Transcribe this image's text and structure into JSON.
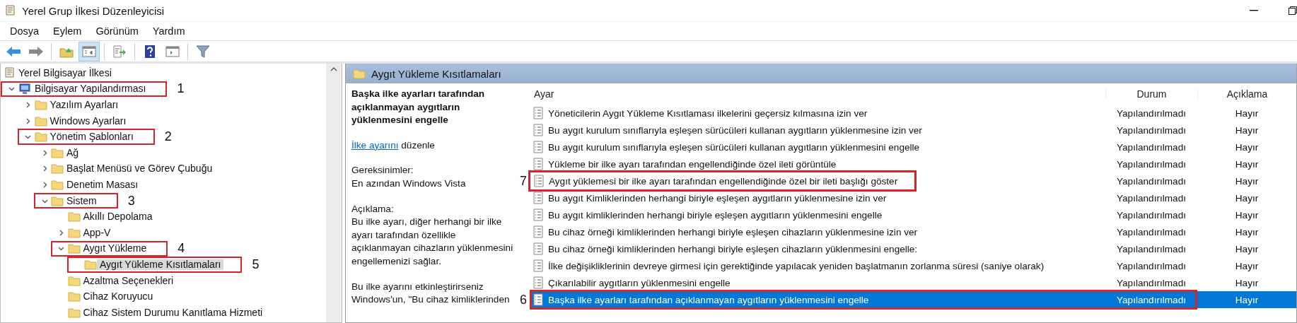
{
  "window": {
    "title": "Yerel Grup İlkesi Düzenleyicisi"
  },
  "menu": [
    "Dosya",
    "Eylem",
    "Görünüm",
    "Yardım"
  ],
  "toolbar": [
    {
      "kind": "back",
      "pressed": false
    },
    {
      "kind": "forward",
      "pressed": false
    },
    {
      "kind": "sep"
    },
    {
      "kind": "up",
      "pressed": false
    },
    {
      "kind": "tree",
      "pressed": true
    },
    {
      "kind": "sep"
    },
    {
      "kind": "export",
      "pressed": false
    },
    {
      "kind": "sep"
    },
    {
      "kind": "help",
      "pressed": false
    },
    {
      "kind": "panel",
      "pressed": false
    },
    {
      "kind": "sep"
    },
    {
      "kind": "filter",
      "pressed": false
    }
  ],
  "tree": {
    "items": [
      {
        "label": "Yerel Bilgisayar İlkesi",
        "kind": "policy",
        "selected": false,
        "children": [
          {
            "label": "Bilgisayar Yapılandırması",
            "kind": "computer",
            "expanded": true,
            "selected": false,
            "callout": "1",
            "children": [
              {
                "label": "Yazılım Ayarları",
                "kind": "folder",
                "expanded": false,
                "selected": false
              },
              {
                "label": "Windows Ayarları",
                "kind": "folder",
                "expanded": false,
                "selected": false
              },
              {
                "label": "Yönetim Şablonları",
                "kind": "folder",
                "expanded": true,
                "selected": false,
                "callout": "2",
                "children": [
                  {
                    "label": "Ağ",
                    "kind": "folder",
                    "expanded": false,
                    "selected": false
                  },
                  {
                    "label": "Başlat Menüsü ve Görev Çubuğu",
                    "kind": "folder",
                    "expanded": false,
                    "selected": false
                  },
                  {
                    "label": "Denetim Masası",
                    "kind": "folder",
                    "expanded": false,
                    "selected": false
                  },
                  {
                    "label": "Sistem",
                    "kind": "folder",
                    "expanded": true,
                    "selected": false,
                    "callout": "3",
                    "children": [
                      {
                        "label": "Akıllı Depolama",
                        "kind": "folder",
                        "selected": false
                      },
                      {
                        "label": "App-V",
                        "kind": "folder",
                        "expanded": false,
                        "selected": false
                      },
                      {
                        "label": "Aygıt Yükleme",
                        "kind": "folder",
                        "expanded": true,
                        "selected": false,
                        "callout": "4",
                        "children": [
                          {
                            "label": "Aygıt Yükleme Kısıtlamaları",
                            "kind": "folder",
                            "selected": true,
                            "callout": "5"
                          }
                        ]
                      },
                      {
                        "label": "Azaltma Seçenekleri",
                        "kind": "folder",
                        "selected": false
                      },
                      {
                        "label": "Cihaz Koruyucu",
                        "kind": "folder",
                        "selected": false
                      },
                      {
                        "label": "Cihaz Sistem Durumu Kanıtlama Hizmeti",
                        "kind": "folder",
                        "selected": false
                      }
                    ]
                  }
                ]
              }
            ]
          }
        ]
      }
    ]
  },
  "panel": {
    "title": "Aygıt Yükleme Kısıtlamaları",
    "description": {
      "title": "Başka ilke ayarları tarafından açıklanmayan aygıtların yüklenmesini engelle",
      "edit_link": {
        "link": "İlke ayarını",
        "rest": "düzenle"
      },
      "requirements_label": "Gereksinimler:",
      "requirements": "En azından Windows Vista",
      "explanation_label": "Açıklama:",
      "explanation": "Bu ilke ayarı, diğer herhangi bir ilke ayarı tarafından özellikle açıklanmayan cihazların yüklenmesini engellemenizi sağlar.",
      "more": "Bu ilke ayarını etkinleştirirseniz Windows'un, \"Bu cihaz kimliklerinden"
    },
    "table": {
      "columns": [
        "Ayar",
        "Durum",
        "Açıklama"
      ],
      "rows": [
        {
          "setting": "Yöneticilerin Aygıt Yükleme Kısıtlaması ilkelerini geçersiz kılmasına izin ver",
          "status": "Yapılandırılmadı",
          "comment": "Hayır",
          "selected": false
        },
        {
          "setting": "Bu aygıt kurulum sınıflarıyla eşleşen sürücüleri kullanan aygıtların yüklenmesine izin ver",
          "status": "Yapılandırılmadı",
          "comment": "Hayır",
          "selected": false
        },
        {
          "setting": "Bu aygıt kurulum sınıflarıyla eşleşen sürücüleri kullanan aygıtların yüklenmesini engelle",
          "status": "Yapılandırılmadı",
          "comment": "Hayır",
          "selected": false
        },
        {
          "setting": "Yükleme bir ilke ayarı tarafından engellendiğinde özel ileti görüntüle",
          "status": "Yapılandırılmadı",
          "comment": "Hayır",
          "selected": false
        },
        {
          "setting": "Aygıt yüklemesi bir ilke ayarı tarafından engellendiğinde özel bir ileti başlığı göster",
          "status": "Yapılandırılmadı",
          "comment": "Hayır",
          "selected": false,
          "callout": {
            "number": "7",
            "kind": "text"
          }
        },
        {
          "setting": "Bu aygıt Kimliklerinden herhangi biriyle eşleşen aygıtların yüklenmesine izin ver",
          "status": "Yapılandırılmadı",
          "comment": "Hayır",
          "selected": false
        },
        {
          "setting": "Bu aygıt kimliklerinden herhangi biriyle eşleşen aygıtların yüklenmesini engelle",
          "status": "Yapılandırılmadı",
          "comment": "Hayır",
          "selected": false
        },
        {
          "setting": "Bu cihaz örneği kimliklerinden herhangi biriyle eşleşen cihazların yüklenmesine izin ver",
          "status": "Yapılandırılmadı",
          "comment": "Hayır",
          "selected": false
        },
        {
          "setting": "Bu cihaz örneği kimliklerinden herhangi biriyle eşleşen cihazların yüklenmesini engelle:",
          "status": "Yapılandırılmadı",
          "comment": "Hayır",
          "selected": false
        },
        {
          "setting": "İlke değişikliklerinin devreye girmesi için gerektiğinde yapılacak yeniden başlatmanın zorlanma süresi (saniye olarak)",
          "status": "Yapılandırılmadı",
          "comment": "Hayır",
          "selected": false
        },
        {
          "setting": "Çıkarılabilir aygıtların yüklenmesini engelle",
          "status": "Yapılandırılmadı",
          "comment": "Hayır",
          "selected": false
        },
        {
          "setting": "Başka ilke ayarları tarafından açıklanmayan aygıtların yüklenmesini engelle",
          "status": "Yapılandırılmadı",
          "comment": "Hayır",
          "selected": true,
          "callout": {
            "number": "6",
            "kind": "row"
          }
        }
      ]
    }
  }
}
